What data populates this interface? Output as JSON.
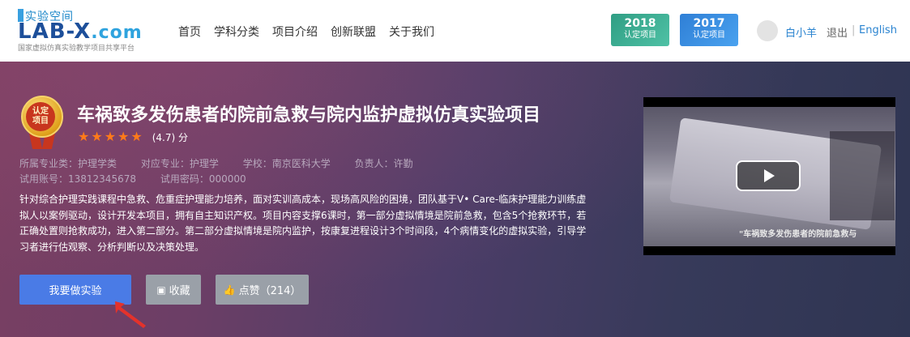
{
  "header": {
    "logo": {
      "top": "实验空间",
      "main_a": "LAB-X",
      "main_b": ".com",
      "sub": "国家虚拟仿真实验教学项目共享平台"
    },
    "nav": [
      "首页",
      "学科分类",
      "项目介绍",
      "创新联盟",
      "关于我们"
    ],
    "badges": [
      {
        "year": "2018",
        "text": "认定项目",
        "color": "#3aae92"
      },
      {
        "year": "2017",
        "text": "认定项目",
        "color": "#3a8fe2"
      }
    ],
    "user_name": "白小羊",
    "logout_label": "退出",
    "separator": "|",
    "lang_label": "English"
  },
  "project": {
    "medal_text": "认定\n项目",
    "title": "车祸致多发伤患者的院前急救与院内监护虚拟仿真实验项目",
    "rating_stars": 5,
    "rating_text": "(4.7) 分",
    "meta_line1": [
      "所属专业类：护理学类",
      "对应专业：护理学",
      "学校：南京医科大学",
      "负责人：许勤"
    ],
    "meta_line2": [
      "试用账号：13812345678",
      "试用密码：000000"
    ],
    "description": "针对综合护理实践课程中急救、危重症护理能力培养，面对实训高成本，现场高风险的困境，团队基于V• Care-临床护理能力训练虚拟人以案例驱动，设计开发本项目，拥有自主知识产权。项目内容支撑6课时，第一部分虚拟情境是院前急救，包含5个抢救环节，若正确处置则抢救成功，进入第二部分。第二部分虚拟情境是院内监护，按康复进程设计3个时间段，4个病情变化的虚拟实验，引导学习者进行估观察、分析判断以及决策处理。",
    "buttons": {
      "start": "我要做实验",
      "favorite": "收藏",
      "like": "点赞（214）"
    },
    "video_caption": "\"车祸致多发伤患者的院前急救与"
  },
  "colors": {
    "accent": "#4a7be6",
    "star": "#ff7a1a",
    "link": "#2b84d0"
  }
}
